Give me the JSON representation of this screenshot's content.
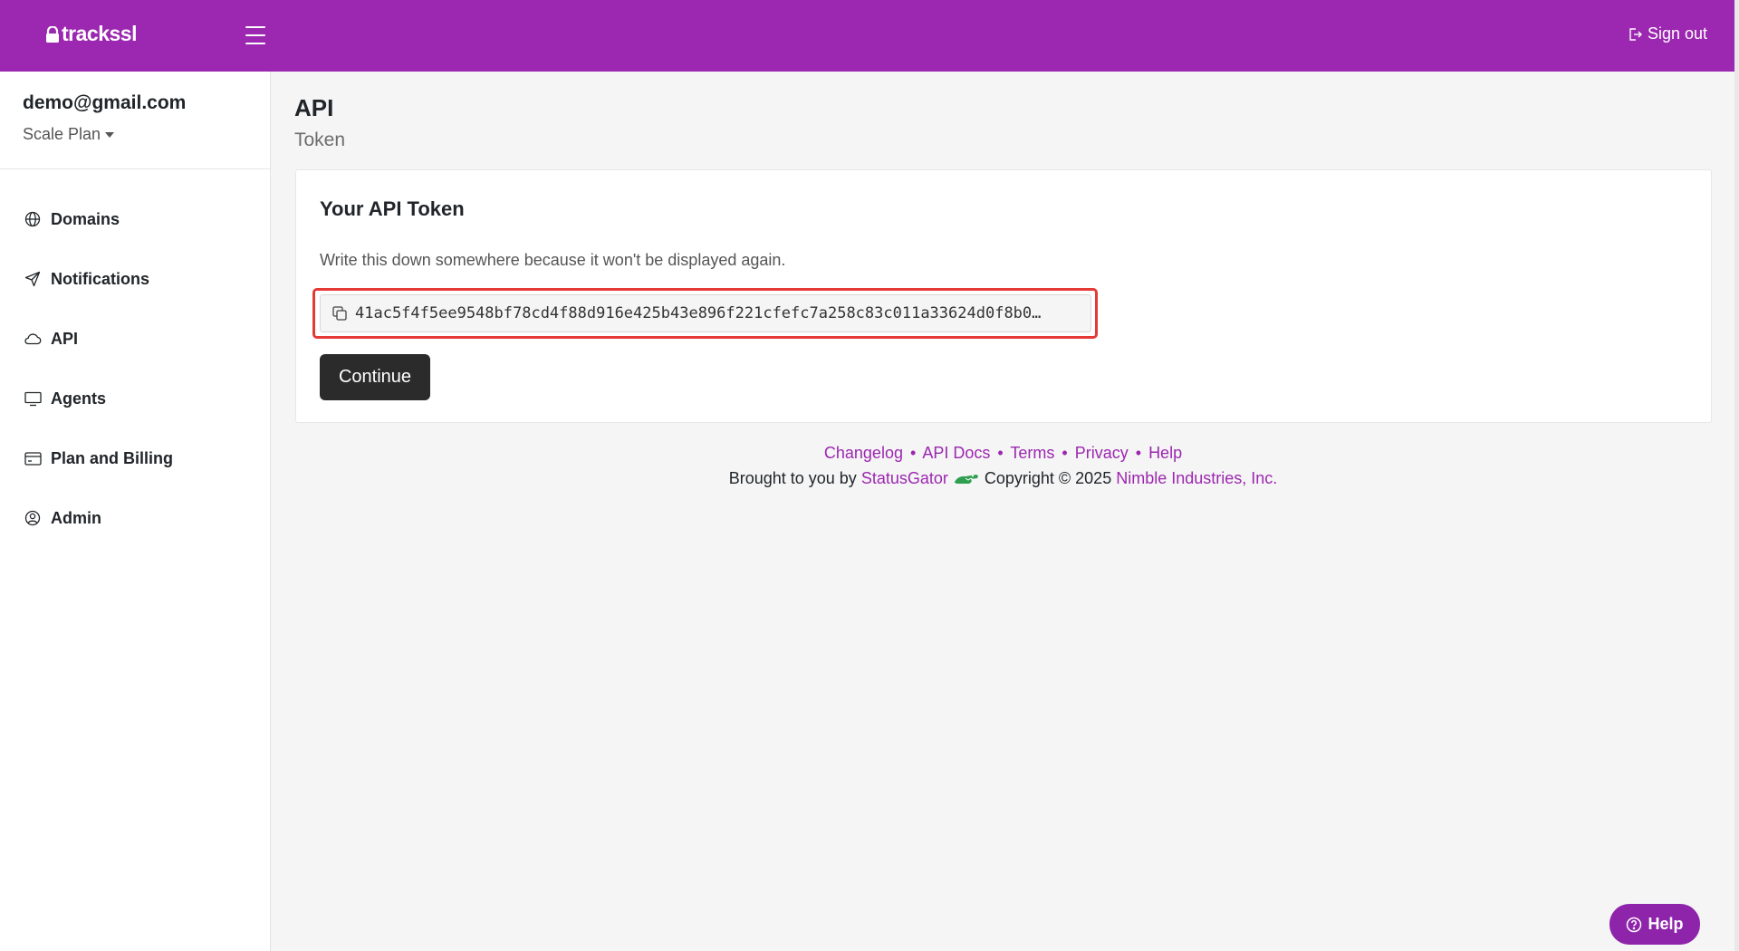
{
  "header": {
    "brand": "trackssl",
    "sign_out_label": "Sign out",
    "accent_color": "#9c27b0"
  },
  "sidebar": {
    "user_email": "demo@gmail.com",
    "plan_label": "Scale Plan",
    "items": [
      {
        "label": "Domains",
        "icon": "globe-icon"
      },
      {
        "label": "Notifications",
        "icon": "send-icon"
      },
      {
        "label": "API",
        "icon": "cloud-icon"
      },
      {
        "label": "Agents",
        "icon": "monitor-icon"
      },
      {
        "label": "Plan and Billing",
        "icon": "credit-card-icon"
      },
      {
        "label": "Admin",
        "icon": "user-circle-icon"
      }
    ]
  },
  "main": {
    "title": "API",
    "subtitle": "Token",
    "card": {
      "title": "Your API Token",
      "note": "Write this down somewhere because it won't be displayed again.",
      "token": "41ac5f4f5ee9548bf78cd4f88d916e425b43e896f221cfefc7a258c83c011a33624d0f8b0…",
      "continue_label": "Continue"
    }
  },
  "footer": {
    "links": [
      "Changelog",
      "API Docs",
      "Terms",
      "Privacy",
      "Help"
    ],
    "separator": "•",
    "brought_by": "Brought to you by",
    "statusgator": "StatusGator",
    "copyright": "Copyright © 2025",
    "company": "Nimble Industries, Inc."
  },
  "help_widget": {
    "label": "Help"
  }
}
